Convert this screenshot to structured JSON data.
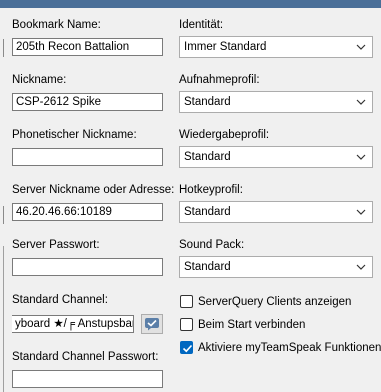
{
  "left": {
    "bookmark_name_label": "Bookmark Name:",
    "bookmark_name_value": "205th Recon Battalion",
    "nickname_label": "Nickname:",
    "nickname_value": "CSP-2612 Spike",
    "phonetic_nickname_label": "Phonetischer Nickname:",
    "phonetic_nickname_value": "",
    "server_address_label": "Server Nickname oder Adresse:",
    "server_address_value": "46.20.46.66:10189",
    "server_password_label": "Server Passwort:",
    "server_password_value": "",
    "default_channel_label": "Standard Channel:",
    "default_channel_value": "yboard ★/╒ Anstupsbar",
    "default_channel_password_label": "Standard Channel Passwort:",
    "default_channel_password_value": ""
  },
  "right": {
    "identity_label": "Identität:",
    "identity_value": "Immer Standard",
    "capture_label": "Aufnahmeprofil:",
    "capture_value": "Standard",
    "playback_label": "Wiedergabeprofil:",
    "playback_value": "Standard",
    "hotkey_label": "Hotkeyprofil:",
    "hotkey_value": "Standard",
    "soundpack_label": "Sound Pack:",
    "soundpack_value": "Standard",
    "checkboxes": [
      {
        "label": "ServerQuery Clients anzeigen",
        "checked": false
      },
      {
        "label": "Beim Start verbinden",
        "checked": false
      },
      {
        "label": "Aktiviere myTeamSpeak Funktionen",
        "checked": true
      }
    ]
  },
  "icons": {
    "channel_picker": "channel-picker-icon",
    "dropdown": "chevron-down-icon",
    "checkmark": "checkmark-icon"
  },
  "colors": {
    "header": "#4a6f98",
    "checkbox_checked": "#0067c0"
  }
}
